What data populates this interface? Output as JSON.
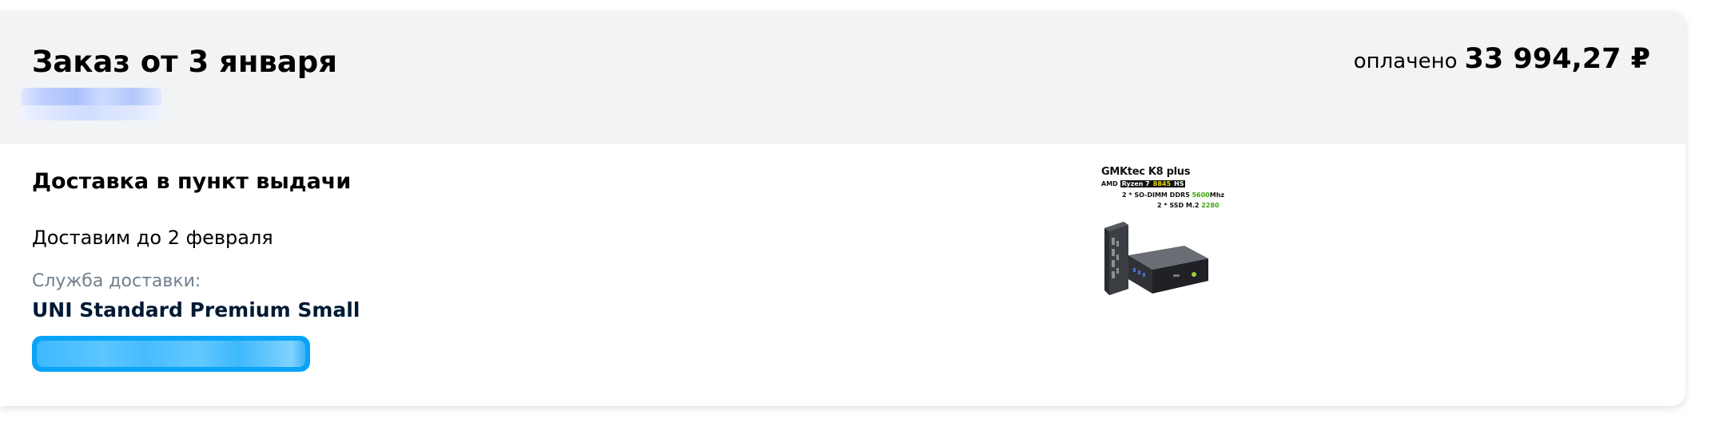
{
  "order": {
    "title": "Заказ от 3 января",
    "paid_label": "оплачено",
    "paid_amount": "33 994,27 ₽"
  },
  "delivery": {
    "type": "Доставка в пункт выдачи",
    "date": "Доставим до 2 февраля",
    "service_label": "Служба доставки:",
    "service_name": "UNI Standard Premium Small"
  },
  "product": {
    "title": "GMKtec K8 plus",
    "line1_brand": "AMD",
    "line1_model": "Ryzen 7",
    "line1_chip": "8845",
    "line1_suffix": "HS",
    "line2_prefix": "2 * SO-DIMM DDR5 ",
    "line2_speed": "5600",
    "line2_unit": "Mhz",
    "line3_prefix": "2 * SSD M.2 ",
    "line3_size": "2280"
  },
  "colors": {
    "header_bg": "#f2f3f5",
    "accent": "#0aa3f6",
    "muted_text": "#707f8d",
    "primary_text": "#001a34"
  }
}
